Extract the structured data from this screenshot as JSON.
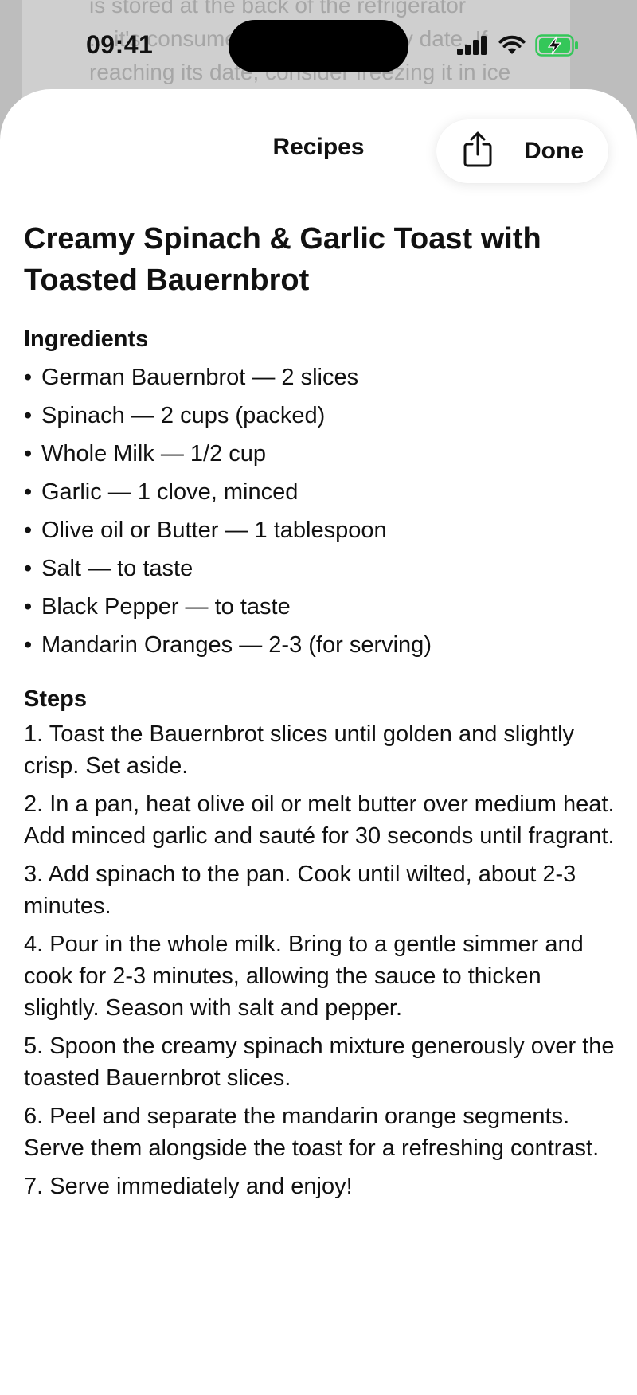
{
  "status_bar": {
    "time": "09:41"
  },
  "background": {
    "text": "is stored at the back of the refrigerator\n... it's consumed before its expiry date. If\nreaching its date, consider freezing it in ice"
  },
  "nav": {
    "title": "Recipes",
    "share_icon": "share-icon",
    "done_label": "Done"
  },
  "recipe": {
    "title": "Creamy Spinach & Garlic Toast with Toasted Bauernbrot",
    "ingredients_heading": "Ingredients",
    "ingredients": [
      "German Bauernbrot — 2 slices",
      "Spinach — 2 cups (packed)",
      "Whole Milk — 1/2 cup",
      "Garlic — 1 clove, minced",
      "Olive oil or Butter — 1 tablespoon",
      "Salt — to taste",
      "Black Pepper — to taste",
      "Mandarin Oranges — 2-3 (for serving)"
    ],
    "steps_heading": "Steps",
    "steps": [
      "1. Toast the Bauernbrot slices until golden and slightly crisp. Set aside.",
      "2. In a pan, heat olive oil or melt butter over medium heat. Add minced garlic and sauté for 30 seconds until fragrant.",
      "3. Add spinach to the pan. Cook until wilted, about 2-3 minutes.",
      "4. Pour in the whole milk. Bring to a gentle simmer and cook for 2-3 minutes, allowing the sauce to thicken slightly. Season with salt and pepper.",
      "5. Spoon the creamy spinach mixture generously over the toasted Bauernbrot slices.",
      "6. Peel and separate the mandarin orange segments. Serve them alongside the toast for a refreshing contrast.",
      "7. Serve immediately and enjoy!"
    ]
  },
  "colors": {
    "battery_green": "#34c759",
    "sheet_background": "#ffffff",
    "backdrop": "#bdbdbd"
  }
}
